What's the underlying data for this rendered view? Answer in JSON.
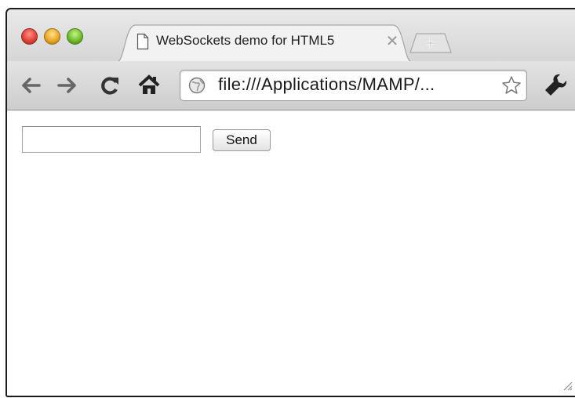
{
  "tab": {
    "title": "WebSockets demo for HTML5",
    "page_icon": "page-icon",
    "close_icon": "close-icon"
  },
  "toolbar": {
    "back_icon": "back-arrow-icon",
    "forward_icon": "forward-arrow-icon",
    "reload_icon": "reload-icon",
    "home_icon": "home-icon",
    "url": "file:///Applications/MAMP/...",
    "star_icon": "bookmark-star-icon",
    "wrench_icon": "wrench-icon"
  },
  "page": {
    "message_input_value": "",
    "send_label": "Send"
  },
  "colors": {
    "close_red": "#e0443a",
    "minimize_yellow": "#e9a826",
    "zoom_green": "#6fbd2c",
    "toolbar_icon": "#555555"
  }
}
